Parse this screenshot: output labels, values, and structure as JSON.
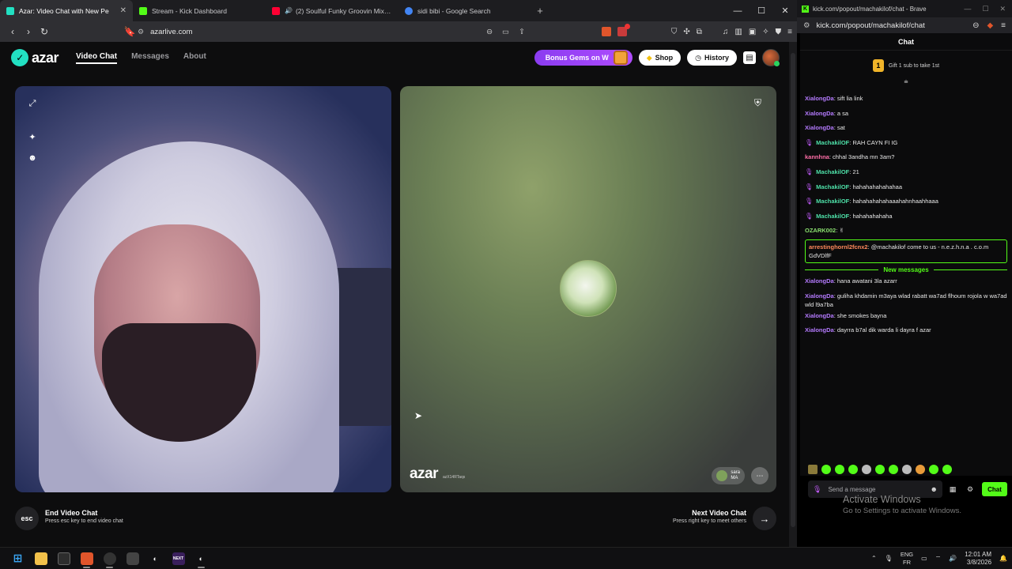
{
  "browser": {
    "tabs": [
      {
        "label": "Azar: Video Chat with New Pe",
        "color": "#22e0c2",
        "active": true
      },
      {
        "label": "Stream - Kick Dashboard",
        "color": "#53fc18",
        "active": false
      },
      {
        "label": "(2) Soulful Funky Groovin Mix - R",
        "color": "#ff0033",
        "active": false
      },
      {
        "label": "sidi bibi - Google Search",
        "color": "#4285f4",
        "active": false
      }
    ],
    "url": "azarlive.com",
    "brave_badge_count": "1"
  },
  "azar": {
    "logo_text": "azar",
    "nav": {
      "video_chat": "Video Chat",
      "messages": "Messages",
      "about": "About"
    },
    "bonus_label": "Bonus Gems on W",
    "shop_label": "Shop",
    "history_label": "History",
    "watermark": "azar",
    "peer_id": "azX14RTaqs",
    "peer": {
      "name": "sara",
      "country": "MA"
    },
    "bottom": {
      "esc_label": "esc",
      "end_title": "End Video Chat",
      "end_hint": "Press esc key to end video chat",
      "next_title": "Next Video Chat",
      "next_hint": "Press right key to meet others"
    }
  },
  "popup": {
    "title": "kick.com/popout/machakilof/chat - Brave",
    "address": "kick.com/popout/machakilof/chat",
    "chat_header": "Chat",
    "gift_count": "1",
    "gift_text": "Gift 1 sub to take 1st",
    "new_messages_label": "New messages",
    "messages_before": [
      {
        "user": "XialongDa",
        "color": "#b57bff",
        "text": "sift lia link",
        "mic": false
      },
      {
        "user": "XialongDa",
        "color": "#b57bff",
        "text": "a sa",
        "mic": false
      },
      {
        "user": "XialongDa",
        "color": "#b57bff",
        "text": "sat",
        "mic": false
      },
      {
        "user": "MachakilOF",
        "color": "#4ee0a8",
        "text": "RAH CAYN FI IG",
        "mic": true
      },
      {
        "user": "kannhna",
        "color": "#ff6fa8",
        "text": "chhal 3andha mn 3am?",
        "mic": false
      },
      {
        "user": "MachakilOF",
        "color": "#4ee0a8",
        "text": "21",
        "mic": true
      },
      {
        "user": "MachakilOF",
        "color": "#4ee0a8",
        "text": "hahahahahahahaa",
        "mic": true
      },
      {
        "user": "MachakilOF",
        "color": "#4ee0a8",
        "text": "hahahahahahaaahahnhaahhaaa",
        "mic": true
      },
      {
        "user": "MachakilOF",
        "color": "#4ee0a8",
        "text": "hahahahahaha",
        "mic": true
      },
      {
        "user": "OZARK002",
        "color": "#8be070",
        "text": "✌",
        "mic": false
      }
    ],
    "highlight": {
      "user": "arrestinghornl2fcnx2",
      "color": "#ff8a5c",
      "text": "@machakilof come to us - n.e.z.h.n.a . c.o.m GdVDlfF"
    },
    "messages_after": [
      {
        "user": "XialongDa",
        "color": "#b57bff",
        "text": "hana awatani 3la azarr"
      },
      {
        "user": "XialongDa",
        "color": "#b57bff",
        "text": "guliha khdamin m3aya wlad rabatt wa7ad flhoum rojola w wa7ad wld l9a7ba"
      },
      {
        "user": "XialongDa",
        "color": "#b57bff",
        "text": "she smokes bayna"
      },
      {
        "user": "XialongDa",
        "color": "#b57bff",
        "text": "dayrra b7al dik warda li dayra f azar"
      }
    ],
    "input_placeholder": "Send a message",
    "send_label": "Chat"
  },
  "watermark": {
    "title": "Activate Windows",
    "subtitle": "Go to Settings to activate Windows."
  },
  "taskbar": {
    "lang_top": "ENG",
    "lang_bottom": "FR",
    "time": "12:01 AM",
    "date": "3/8/2026",
    "next_label": "NEXT"
  }
}
